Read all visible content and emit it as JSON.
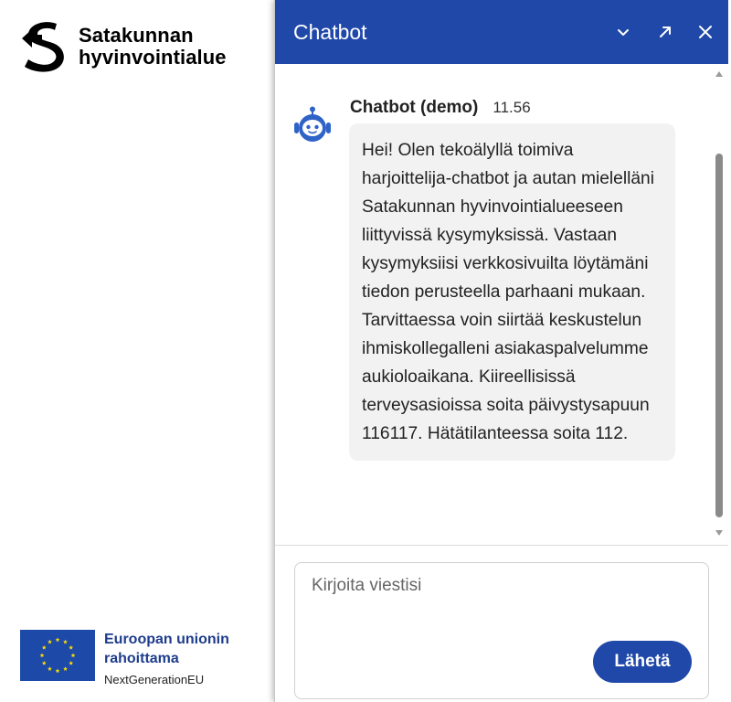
{
  "brand": {
    "line1": "Satakunnan",
    "line2": "hyvinvointialue"
  },
  "eu_badge": {
    "line1": "Euroopan unionin",
    "line2": "rahoittama",
    "line3": "NextGenerationEU"
  },
  "chat": {
    "title": "Chatbot",
    "header_icons": [
      "chevron-down-icon",
      "expand-icon",
      "close-icon"
    ],
    "messages": [
      {
        "sender": "Chatbot (demo)",
        "time": "11.56",
        "text": "Hei! Olen tekoälyllä toimiva harjoittelija-chatbot ja autan mielelläni Satakunnan hyvinvointialueeseen liittyvissä kysymyksissä. Vastaan kysymyksiisi verkkosivuilta löytämäni tiedon perusteella parhaani mukaan. Tarvittaessa voin siirtää keskustelun ihmiskollegalleni asiakaspalvelumme aukioloaikana. Kiireellisissä terveysasioissa soita päivystysapuun 116117. Hätätilanteessa soita 112."
      }
    ],
    "composer": {
      "placeholder": "Kirjoita viestisi",
      "value": "",
      "send_label": "Lähetä"
    }
  },
  "colors": {
    "header_bg": "#1f48a8",
    "send_button_bg": "#1f48a8",
    "bubble_bg": "#f2f2f2",
    "eu_text": "#1e3c8c"
  }
}
